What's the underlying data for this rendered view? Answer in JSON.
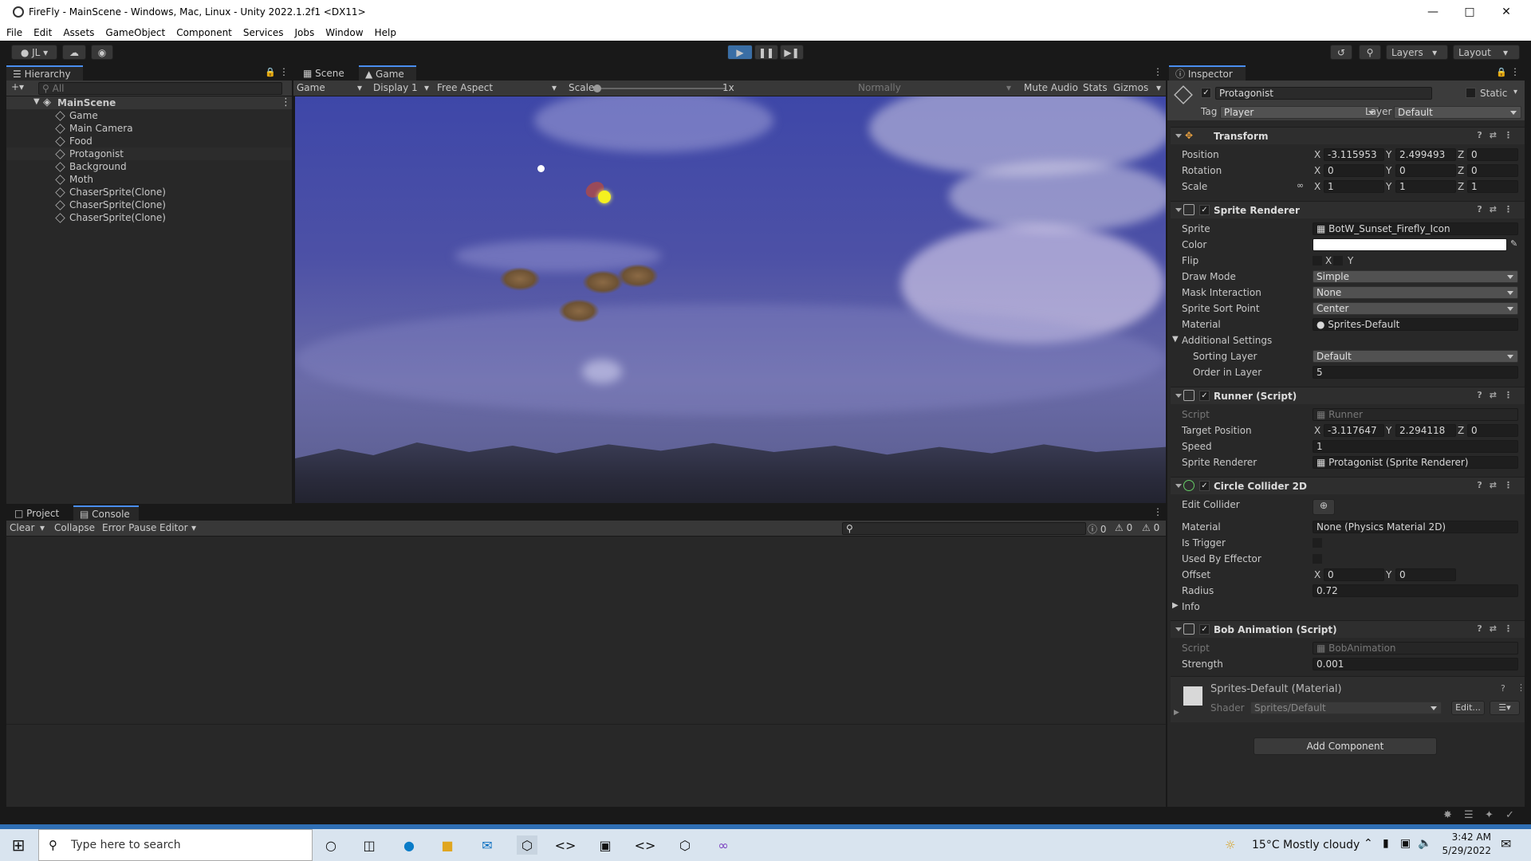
{
  "window": {
    "title": "FireFly - MainScene - Windows, Mac, Linux - Unity 2022.1.2f1 <DX11>"
  },
  "menu": [
    "File",
    "Edit",
    "Assets",
    "GameObject",
    "Component",
    "Services",
    "Jobs",
    "Window",
    "Help"
  ],
  "toolbar": {
    "account": "JL",
    "layers": "Layers",
    "layout": "Layout"
  },
  "hierarchy": {
    "tab": "Hierarchy",
    "search_placeholder": "All",
    "scene": "MainScene",
    "items": [
      "Game",
      "Main Camera",
      "Food",
      "Protagonist",
      "Background",
      "Moth",
      "ChaserSprite(Clone)",
      "ChaserSprite(Clone)",
      "ChaserSprite(Clone)"
    ]
  },
  "view_tabs": {
    "scene": "Scene",
    "game": "Game"
  },
  "game_bar": {
    "mode": "Game",
    "display": "Display 1",
    "aspect": "Free Aspect",
    "scale_label": "Scale",
    "scale_value": "1x",
    "normally": "Normally",
    "mute": "Mute Audio",
    "stats": "Stats",
    "gizmos": "Gizmos"
  },
  "bottom_tabs": {
    "project": "Project",
    "console": "Console"
  },
  "console_bar": {
    "clear": "Clear",
    "collapse": "Collapse",
    "error_pause": "Error Pause",
    "editor": "Editor",
    "count_info": "0",
    "count_warn": "0",
    "count_error": "0"
  },
  "inspector": {
    "tab": "Inspector",
    "object_name": "Protagonist",
    "static": "Static",
    "tag_label": "Tag",
    "tag": "Player",
    "layer_label": "Layer",
    "layer": "Default",
    "transform": {
      "title": "Transform",
      "position_label": "Position",
      "pos": [
        "-3.115953",
        "2.499493",
        "0"
      ],
      "rotation_label": "Rotation",
      "rot": [
        "0",
        "0",
        "0"
      ],
      "scale_label": "Scale",
      "scale": [
        "1",
        "1",
        "1"
      ]
    },
    "sprite_renderer": {
      "title": "Sprite Renderer",
      "sprite_label": "Sprite",
      "sprite": "BotW_Sunset_Firefly_Icon",
      "color_label": "Color",
      "flip_label": "Flip",
      "flip_x": "X",
      "flip_y": "Y",
      "draw_mode_label": "Draw Mode",
      "draw_mode": "Simple",
      "mask_label": "Mask Interaction",
      "mask": "None",
      "sort_point_label": "Sprite Sort Point",
      "sort_point": "Center",
      "material_label": "Material",
      "material": "Sprites-Default",
      "additional": "Additional Settings",
      "sorting_layer_label": "Sorting Layer",
      "sorting_layer": "Default",
      "order_label": "Order in Layer",
      "order": "5"
    },
    "runner": {
      "title": "Runner (Script)",
      "script_label": "Script",
      "script": "Runner",
      "target_label": "Target Position",
      "target": [
        "-3.117647",
        "2.294118",
        "0"
      ],
      "speed_label": "Speed",
      "speed": "1",
      "renderer_label": "Sprite Renderer",
      "renderer": "Protagonist (Sprite Renderer)"
    },
    "collider": {
      "title": "Circle Collider 2D",
      "edit_label": "Edit Collider",
      "material_label": "Material",
      "material": "None (Physics Material 2D)",
      "trigger_label": "Is Trigger",
      "effector_label": "Used By Effector",
      "offset_label": "Offset",
      "offset": [
        "0",
        "0"
      ],
      "radius_label": "Radius",
      "radius": "0.72",
      "info": "Info"
    },
    "bob": {
      "title": "Bob Animation (Script)",
      "script_label": "Script",
      "script": "BobAnimation",
      "strength_label": "Strength",
      "strength": "0.001"
    },
    "material_block": {
      "name": "Sprites-Default (Material)",
      "shader_label": "Shader",
      "shader": "Sprites/Default",
      "edit": "Edit..."
    },
    "add_component": "Add Component"
  },
  "taskbar": {
    "search_placeholder": "Type here to search",
    "weather": "15°C  Mostly cloudy",
    "time": "3:42 AM",
    "date": "5/29/2022"
  },
  "colors": {
    "accent": "#4a8ef0",
    "panel": "#282828",
    "header": "#383838",
    "sky_top": "#4b4fa8",
    "sky_bottom": "#6a6aa0"
  }
}
